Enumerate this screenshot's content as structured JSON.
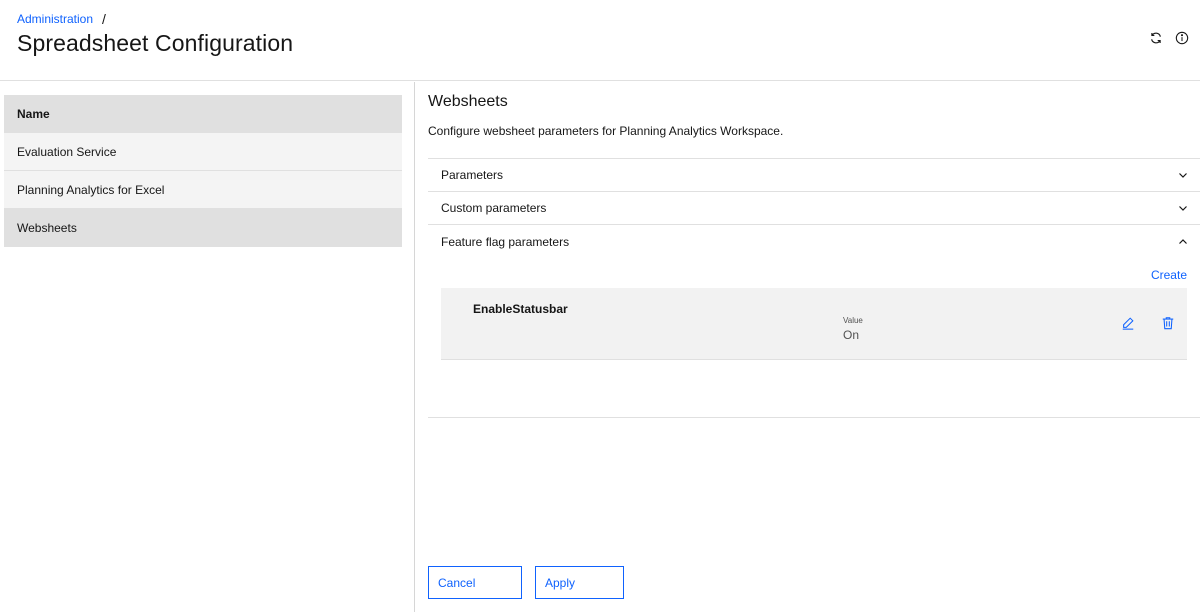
{
  "breadcrumb": {
    "parent": "Administration",
    "separator": "/"
  },
  "page_title": "Spreadsheet Configuration",
  "header_icons": [
    "refresh-icon",
    "info-icon"
  ],
  "name_list": {
    "header": "Name",
    "items": [
      "Evaluation Service",
      "Planning Analytics for Excel",
      "Websheets"
    ],
    "selected": "Websheets"
  },
  "section": {
    "title": "Websheets",
    "description": "Configure websheet parameters for Planning Analytics Workspace."
  },
  "accordion": {
    "items": [
      {
        "label": "Parameters",
        "expanded": false
      },
      {
        "label": "Custom parameters",
        "expanded": false
      },
      {
        "label": "Feature flag parameters",
        "expanded": true
      }
    ]
  },
  "feature_flags": {
    "create_label": "Create",
    "params": [
      {
        "name": "EnableStatusbar",
        "value_label": "Value",
        "value": "On"
      }
    ]
  },
  "footer": {
    "cancel_label": "Cancel",
    "apply_label": "Apply"
  },
  "colors": {
    "accent": "#0f62fe",
    "header_bg": "#e0e0e0",
    "row_bg": "#f4f4f4"
  }
}
